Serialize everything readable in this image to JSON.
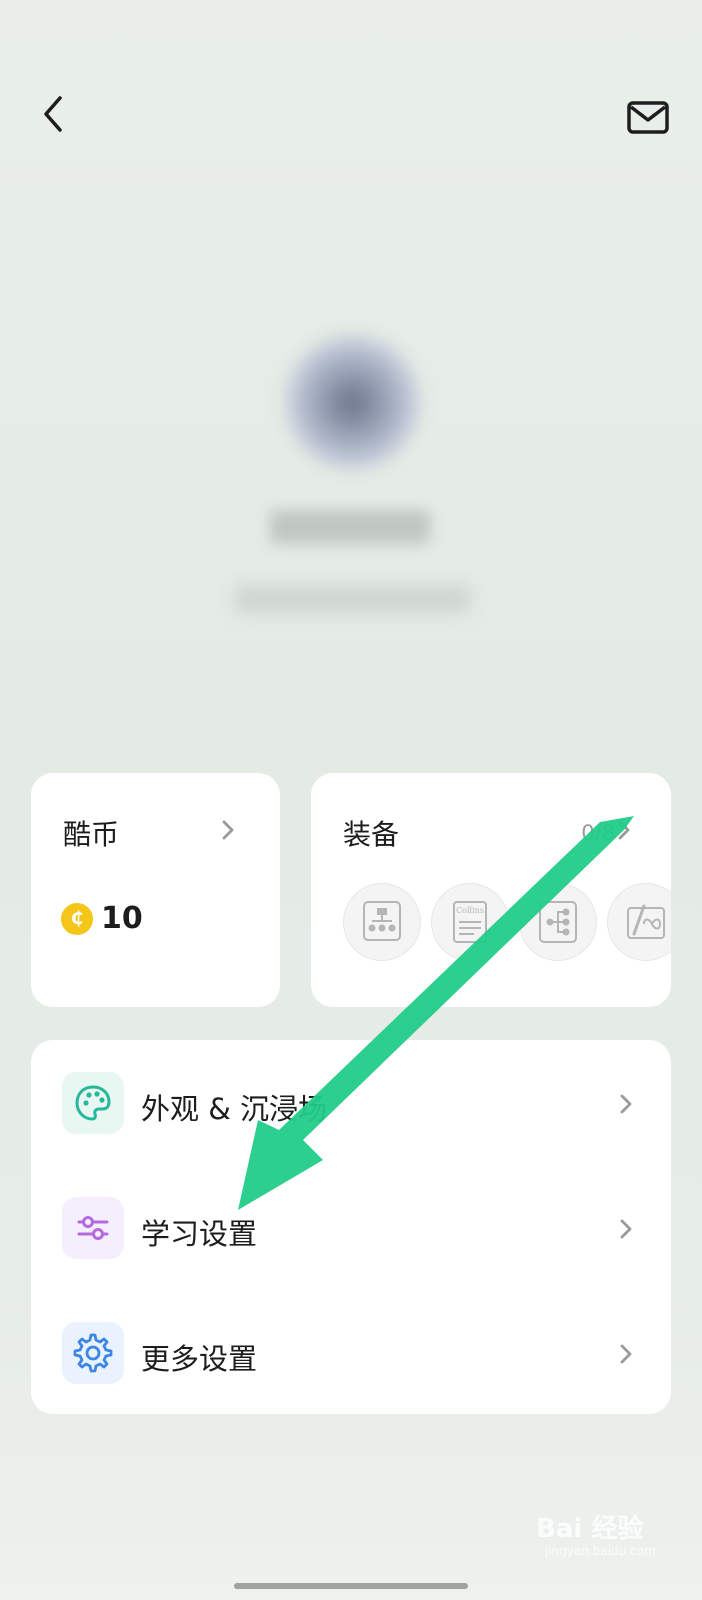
{
  "coins": {
    "title": "酷币",
    "value": "10",
    "coin_icon": "coin-icon",
    "accent": "#f5c518"
  },
  "equipment": {
    "title": "装备",
    "count": "0/8",
    "items": [
      {
        "icon": "mindmap-icon"
      },
      {
        "icon": "collins-dictionary-icon",
        "label": "Collins"
      },
      {
        "icon": "tree-diagram-icon"
      },
      {
        "icon": "pen-infinity-icon"
      }
    ]
  },
  "menu": {
    "items": [
      {
        "label": "外观 & 沉浸场",
        "icon": "palette-icon",
        "icon_color": "#26b89a",
        "icon_bg": "#e9f7f3"
      },
      {
        "label": "学习设置",
        "icon": "sliders-icon",
        "icon_color": "#b46be0",
        "icon_bg": "#f5eefc"
      },
      {
        "label": "更多设置",
        "icon": "gear-icon",
        "icon_color": "#3d86e6",
        "icon_bg": "#eaf2fd"
      }
    ]
  },
  "annotation": {
    "arrow_color": "#22cc88"
  },
  "watermark": {
    "text": "Bai 经验",
    "sub": "jingyan.baidu.com"
  }
}
